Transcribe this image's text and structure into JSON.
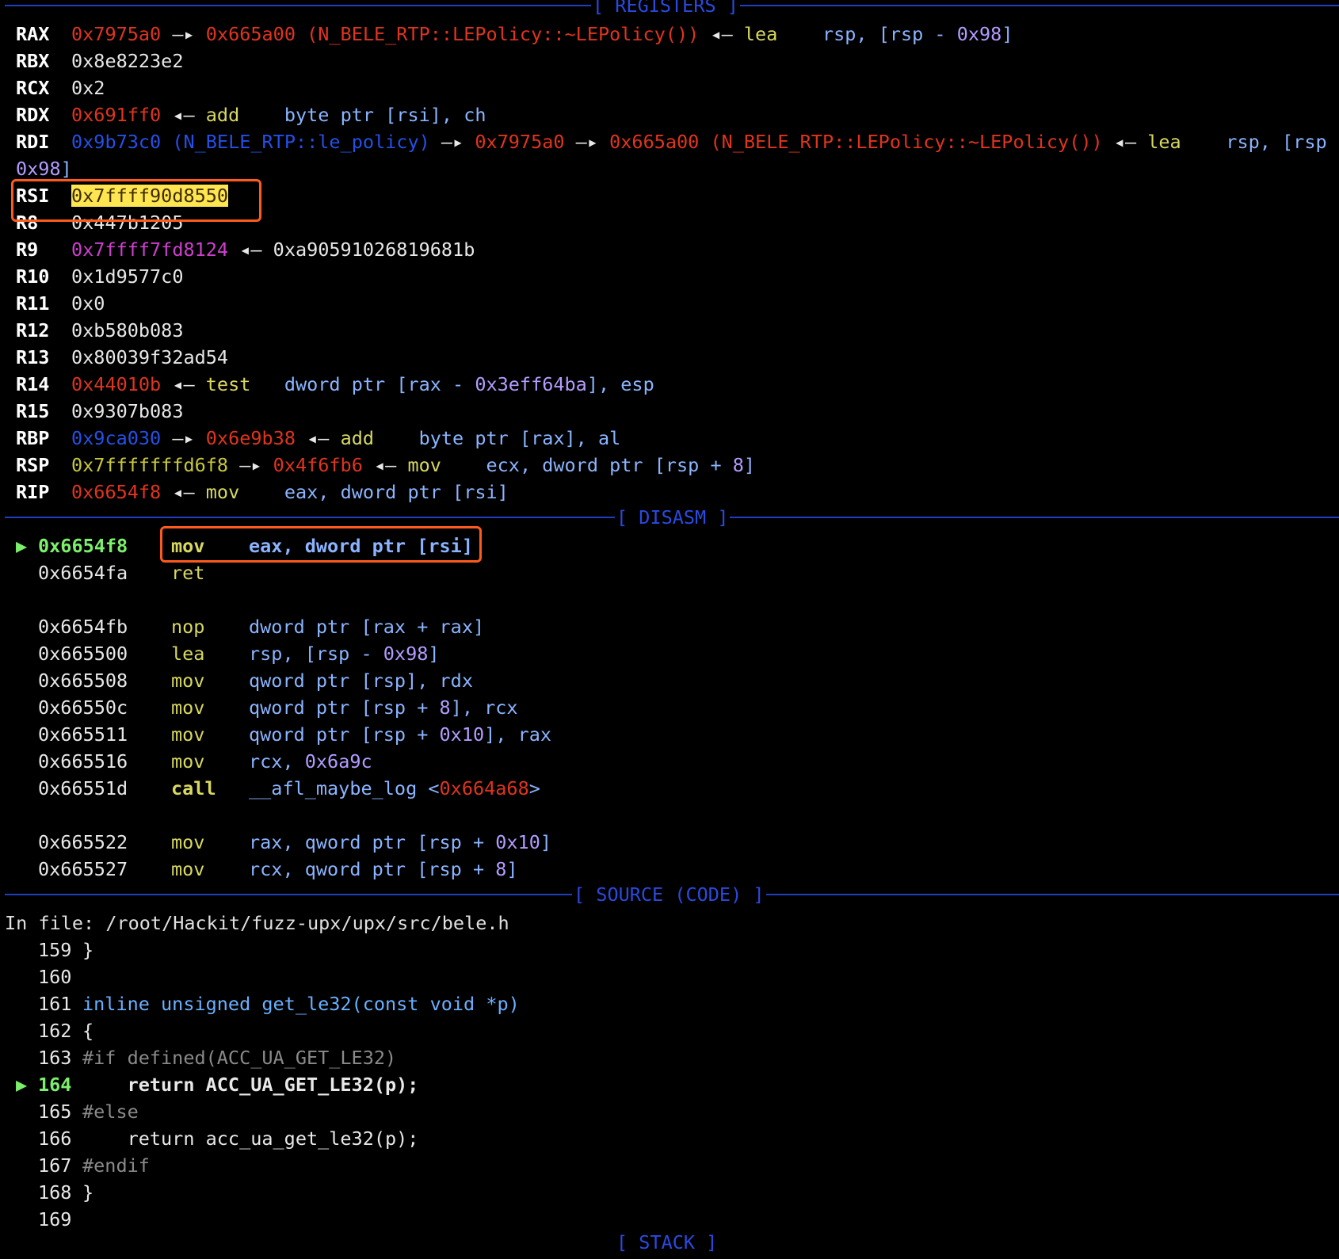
{
  "headers": {
    "registers": "[ REGISTERS ]",
    "disasm": "[ DISASM ]",
    "source": "[ SOURCE (CODE) ]",
    "stack": "[ STACK ]"
  },
  "registers": [
    {
      "name": "RAX",
      "parts": [
        "0x7975a0",
        " —▸ ",
        "0x665a00 (N_BELE_RTP::LEPolicy::~LEPolicy())",
        " ◂— ",
        "lea",
        "    rsp, [rsp - ",
        "0x98",
        "]"
      ]
    },
    {
      "name": "RBX",
      "parts": [
        "0x8e8223e2"
      ]
    },
    {
      "name": "RCX",
      "parts": [
        "0x2"
      ]
    },
    {
      "name": "RDX",
      "parts": [
        "0x691ff0",
        " ◂— ",
        "add",
        "    byte ptr [rsi], ch"
      ]
    },
    {
      "name": "RDI",
      "parts": [
        "0x9b73c0 (N_BELE_RTP::le_policy)",
        " —▸ ",
        "0x7975a0",
        " —▸ ",
        "0x665a00 (N_BELE_RTP::LEPolicy::~LEPolicy())",
        " ◂— ",
        "lea",
        "    rsp, [rsp -"
      ],
      "wrap": [
        "0x98",
        "]"
      ]
    },
    {
      "name": "RSI",
      "parts": [
        "0x7ffff90d8550"
      ]
    },
    {
      "name": "R8",
      "parts": [
        "0x447b1205"
      ]
    },
    {
      "name": "R9",
      "parts": [
        "0x7ffff7fd8124",
        " ◂— ",
        "0xa90591026819681b"
      ]
    },
    {
      "name": "R10",
      "parts": [
        "0x1d9577c0"
      ]
    },
    {
      "name": "R11",
      "parts": [
        "0x0"
      ]
    },
    {
      "name": "R12",
      "parts": [
        "0xb580b083"
      ]
    },
    {
      "name": "R13",
      "parts": [
        "0x80039f32ad54"
      ]
    },
    {
      "name": "R14",
      "parts": [
        "0x44010b",
        " ◂— ",
        "test",
        "   dword ptr [rax - ",
        "0x3eff64ba",
        "], esp"
      ]
    },
    {
      "name": "R15",
      "parts": [
        "0x9307b083"
      ]
    },
    {
      "name": "RBP",
      "parts": [
        "0x9ca030",
        " —▸ ",
        "0x6e9b38",
        " ◂— ",
        "add",
        "    byte ptr [rax], al"
      ]
    },
    {
      "name": "RSP",
      "parts": [
        "0x7fffffffd6f8",
        " —▸ ",
        "0x4f6fb6",
        " ◂— ",
        "mov",
        "    ecx, dword ptr [rsp + ",
        "8",
        "]"
      ]
    },
    {
      "name": "RIP",
      "parts": [
        "0x6654f8",
        " ◂— ",
        "mov",
        "    eax, dword ptr [rsi]"
      ]
    }
  ],
  "disasm": [
    {
      "addr": "0x6654f8",
      "mnem": "mov",
      "ops": "eax, dword ptr [rsi]",
      "current": true
    },
    {
      "addr": "0x6654fa",
      "mnem": "ret",
      "ops": ""
    },
    {
      "addr": "0x6654fb",
      "mnem": "nop",
      "ops": "dword ptr [rax + rax]"
    },
    {
      "addr": "0x665500",
      "mnem": "lea",
      "ops_a": "rsp, [rsp - ",
      "num": "0x98",
      "ops_b": "]"
    },
    {
      "addr": "0x665508",
      "mnem": "mov",
      "ops": "qword ptr [rsp], rdx"
    },
    {
      "addr": "0x66550c",
      "mnem": "mov",
      "ops_a": "qword ptr [rsp + ",
      "num": "8",
      "ops_b": "], rcx"
    },
    {
      "addr": "0x665511",
      "mnem": "mov",
      "ops_a": "qword ptr [rsp + ",
      "num": "0x10",
      "ops_b": "], rax"
    },
    {
      "addr": "0x665516",
      "mnem": "mov",
      "ops_a": "rcx, ",
      "num": "0x6a9c",
      "ops_b": ""
    },
    {
      "addr": "0x66551d",
      "mnem": "call",
      "ops_a": "__afl_maybe_log <",
      "num": "0x664a68",
      "ops_b": ">"
    },
    {
      "addr": "0x665522",
      "mnem": "mov",
      "ops_a": "rax, qword ptr [rsp + ",
      "num": "0x10",
      "ops_b": "]"
    },
    {
      "addr": "0x665527",
      "mnem": "mov",
      "ops_a": "rcx, qword ptr [rsp + ",
      "num": "8",
      "ops_b": "]"
    }
  ],
  "source": {
    "file_line": "In file: /root/Hackit/fuzz-upx/upx/src/bele.h",
    "lines": [
      {
        "no": "159",
        "code": "}"
      },
      {
        "no": "160",
        "code": ""
      },
      {
        "no": "161",
        "code": "inline unsigned get_le32(const void *p)"
      },
      {
        "no": "162",
        "code": "{"
      },
      {
        "no": "163",
        "code": "#if defined(ACC_UA_GET_LE32)"
      },
      {
        "no": "164",
        "code": "    return ACC_UA_GET_LE32(p);",
        "current": true
      },
      {
        "no": "165",
        "code": "#else"
      },
      {
        "no": "166",
        "code": "    return acc_ua_get_le32(p);"
      },
      {
        "no": "167",
        "code": "#endif"
      },
      {
        "no": "168",
        "code": "}"
      },
      {
        "no": "169",
        "code": ""
      }
    ]
  },
  "colors": {
    "background": "#000000",
    "header": "#2a4ae0",
    "highlight_box": "#ff5a1e",
    "current_arrow": "#7bf06b"
  }
}
